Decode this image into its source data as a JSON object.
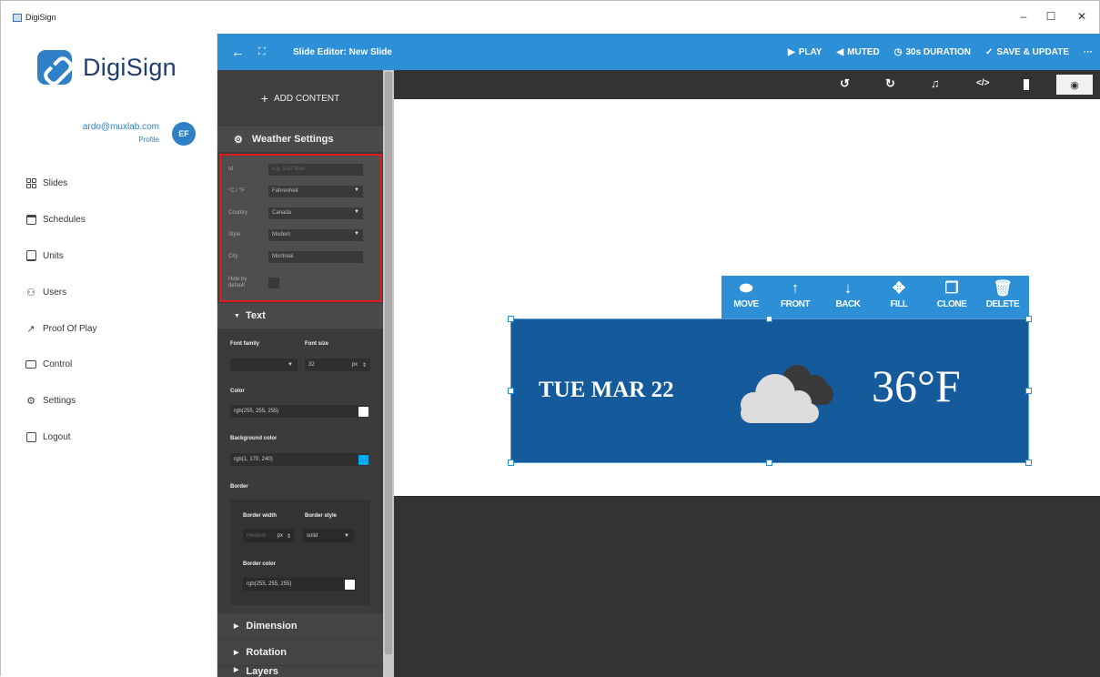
{
  "window": {
    "title": "DigiSign",
    "controls": [
      "–",
      "☐",
      "✕"
    ]
  },
  "sidebar": {
    "logo_text": "DigiSign",
    "profile": {
      "email": "ardo@muxlab.com",
      "link": "Profile",
      "initials": "EF"
    },
    "items": [
      {
        "label": "Slides",
        "icon": "grid-icon"
      },
      {
        "label": "Schedules",
        "icon": "calendar-icon"
      },
      {
        "label": "Units",
        "icon": "server-icon"
      },
      {
        "label": "Users",
        "icon": "user-icon"
      },
      {
        "label": "Proof Of Play",
        "icon": "chart-icon"
      },
      {
        "label": "Control",
        "icon": "monitor-icon"
      },
      {
        "label": "Settings",
        "icon": "gear-icon"
      },
      {
        "label": "Logout",
        "icon": "logout-icon"
      }
    ]
  },
  "topbar": {
    "title": "Slide Editor: New Slide",
    "play": "PLAY",
    "muted": "MUTED",
    "duration": "30s DURATION",
    "save": "SAVE & UPDATE",
    "more": "···"
  },
  "panel": {
    "add_content": "ADD CONTENT",
    "weather_header": "Weather Settings",
    "weather_fields": {
      "id_label": "Id",
      "id_placeholder": "e.g. Surf Now",
      "unit_label": "°C / °F",
      "unit_value": "Fahrenheit",
      "country_label": "Country",
      "country_value": "Canada",
      "style_label": "Style",
      "style_value": "Modern",
      "city_label": "City",
      "city_value": "Montreal",
      "hide_label": "Hide by default"
    },
    "text_header": "Text",
    "font_family_label": "Font family",
    "font_size_label": "Font size",
    "font_size_value": "32",
    "font_size_unit": "px",
    "color_label": "Color",
    "color_value": "rgb(255, 255, 255)",
    "bg_color_label": "Background color",
    "bg_color_value": "rgb(1, 170, 240)",
    "border_label": "Border",
    "border_width_label": "Border width",
    "border_width_value": "medium",
    "border_width_unit": "px",
    "border_style_label": "Border style",
    "border_style_value": "solid",
    "border_color_label": "Border color",
    "border_color_value": "rgb(255, 255, 255)",
    "dimension": "Dimension",
    "rotation": "Rotation",
    "layers": "Layers"
  },
  "element_toolbar": [
    "MOVE",
    "FRONT",
    "BACK",
    "FILL",
    "CLONE",
    "DELETE"
  ],
  "widget": {
    "date": "TUE MAR 22",
    "temperature": "36°F"
  },
  "colors": {
    "accent": "#2d8fd5",
    "panel": "#3b3b3b",
    "widget_bg": "#155a9b",
    "highlight": "#e01b1b",
    "swatch_white": "#ffffff",
    "swatch_blue": "#01aaf0"
  }
}
